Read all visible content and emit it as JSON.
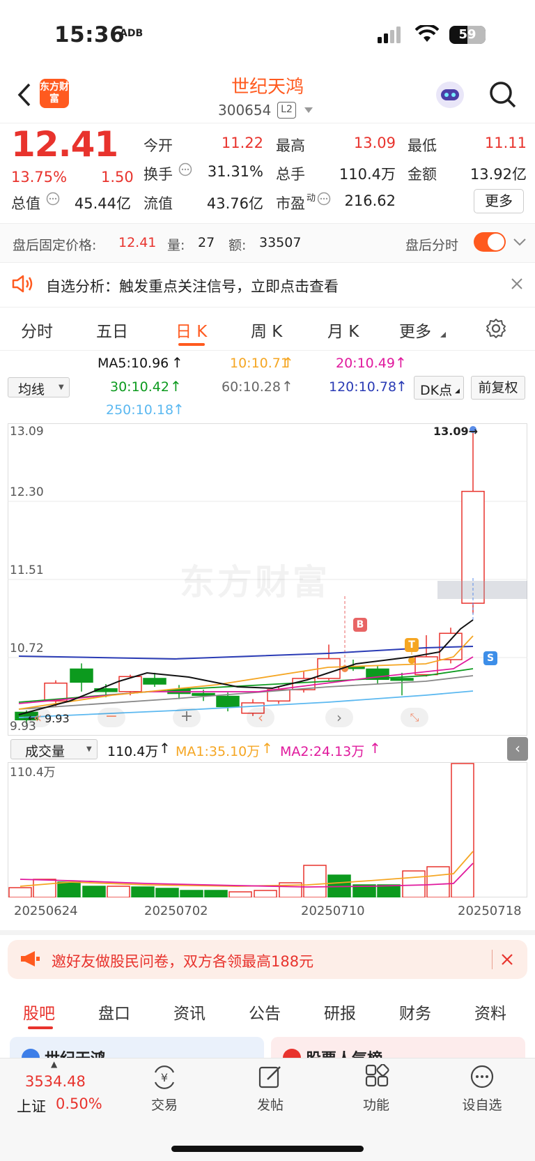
{
  "status_bar": {
    "time": "15:36",
    "badge": "ADB",
    "battery": "59"
  },
  "header": {
    "logo_text": "东方财富",
    "stock_name": "世纪天鸿",
    "stock_code": "300654",
    "level": "L2"
  },
  "quote": {
    "price": "12.41",
    "change_pct": "13.75%",
    "change": "1.50",
    "open_label": "今开",
    "open": "11.22",
    "high_label": "最高",
    "high": "13.09",
    "low_label": "最低",
    "low": "11.11",
    "turnover_label": "换手",
    "turnover": "31.31%",
    "volume_label": "总手",
    "volume": "110.4万",
    "amount_label": "金额",
    "amount": "13.92亿",
    "mktcap_label": "总值",
    "mktcap": "45.44亿",
    "float_label": "流值",
    "float": "43.76亿",
    "pe_label": "市盈",
    "pe_sup": "动",
    "pe": "216.62",
    "more_label": "更多"
  },
  "after_hours": {
    "price_label": "盘后固定价格:",
    "price": "12.41",
    "qty_label": "量:",
    "qty": "27",
    "amt_label": "额:",
    "amt": "33507",
    "toggle_label": "盘后分时"
  },
  "notice": {
    "text": "自选分析：触发重点关注信号，立即点击查看"
  },
  "tabs": [
    "分时",
    "五日",
    "日 K",
    "周 K",
    "月 K",
    "更多"
  ],
  "ma": {
    "selector": "均线",
    "ma5": "MA5:10.96",
    "ma10": "10:10.71",
    "ma20": "20:10.49",
    "ma30": "30:10.42",
    "ma60": "60:10.28",
    "ma120": "120:10.78",
    "ma250": "250:10.18",
    "dk_label": "DK点",
    "fq_label": "前复权"
  },
  "kchart": {
    "y_labels": [
      "13.09",
      "12.30",
      "11.51",
      "10.72",
      "9.93"
    ],
    "high_marker": "13.09→",
    "low_marker": "9.93",
    "watermark": "东方财富",
    "signal_b": "B",
    "signal_t": "T",
    "signal_s": "S"
  },
  "volume": {
    "selector": "成交量",
    "vol": "110.4万",
    "ma1": "MA1:35.10万",
    "ma2": "MA2:24.13万",
    "y_label": "110.4万",
    "dates": [
      "20250624",
      "20250702",
      "20250710",
      "20250718"
    ]
  },
  "promo": {
    "text": "邀好友做股民问卷，双方各领最高188元"
  },
  "bottom_tabs": [
    "股吧",
    "盘口",
    "资讯",
    "公告",
    "研报",
    "财务",
    "资料"
  ],
  "peek": {
    "left": "世纪天鸿",
    "right": "股票人气榜"
  },
  "nav": {
    "index_value": "3534.48",
    "index_name": "上证",
    "index_pct": "0.50%",
    "items": [
      "交易",
      "发帖",
      "功能",
      "设自选"
    ]
  },
  "colors": {
    "up": "#e8332d",
    "down": "#0c9a1e",
    "accent": "#ff5a1f"
  }
}
